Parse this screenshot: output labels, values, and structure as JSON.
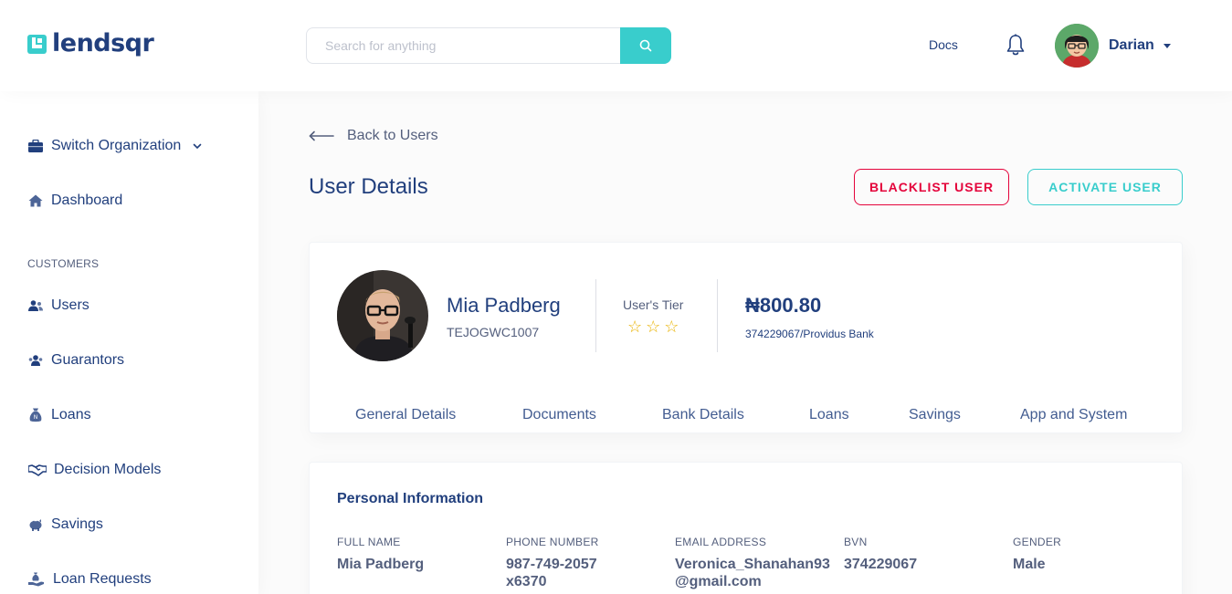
{
  "header": {
    "logo_text": "lendsqr",
    "search_placeholder": "Search for anything",
    "docs_label": "Docs",
    "user_name": "Darian"
  },
  "sidebar": {
    "switch_org": "Switch Organization",
    "dashboard": "Dashboard",
    "section_customers": "CUSTOMERS",
    "items": [
      {
        "label": "Users",
        "icon": "users-icon"
      },
      {
        "label": "Guarantors",
        "icon": "guarantors-icon"
      },
      {
        "label": "Loans",
        "icon": "loan-sack-icon"
      },
      {
        "label": "Decision Models",
        "icon": "handshake-icon"
      },
      {
        "label": "Savings",
        "icon": "piggy-bank-icon"
      },
      {
        "label": "Loan Requests",
        "icon": "loan-request-icon"
      }
    ]
  },
  "main": {
    "back_label": "Back to Users",
    "title": "User Details",
    "blacklist_label": "BLACKLIST USER",
    "activate_label": "ACTIVATE USER"
  },
  "profile": {
    "name": "Mia Padberg",
    "user_id": "TEJOGWC1007",
    "tier_label": "User's Tier",
    "tier_stars": "☆☆☆",
    "tier_value": 0,
    "tier_max": 3,
    "balance": "₦800.80",
    "bank": "374229067/Providus Bank",
    "tabs": [
      "General Details",
      "Documents",
      "Bank Details",
      "Loans",
      "Savings",
      "App and System"
    ]
  },
  "personal_info": {
    "title": "Personal Information",
    "fields": [
      {
        "label": "FULL NAME",
        "value": "Mia Padberg"
      },
      {
        "label": "PHONE NUMBER",
        "value": "987-749-2057 x6370"
      },
      {
        "label": "EMAIL ADDRESS",
        "value": "Veronica_Shanahan93@gmail.com"
      },
      {
        "label": "BVN",
        "value": "374229067"
      },
      {
        "label": "GENDER",
        "value": "Male"
      }
    ]
  },
  "colors": {
    "primary": "#213F7D",
    "accent": "#39CDCC",
    "danger": "#E4033B",
    "star": "#E9B200",
    "muted": "#545F7D"
  }
}
